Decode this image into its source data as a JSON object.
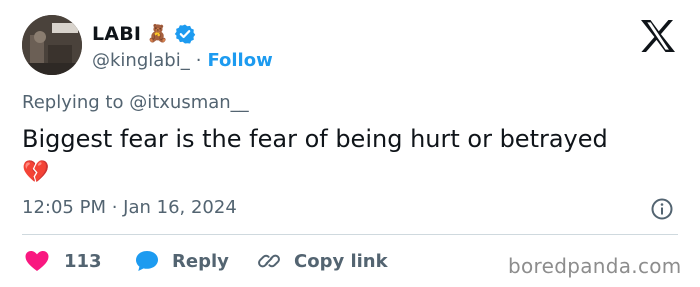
{
  "author": {
    "display_name": "LABI",
    "name_emoji": "🧸",
    "verified_icon": "verified-badge-icon",
    "handle": "@kinglabi_",
    "separator": "·",
    "follow_label": "Follow"
  },
  "reply_context": "Replying to @itxusman__",
  "tweet": {
    "text": "Biggest fear is the fear of being hurt or betrayed",
    "emoji": "💔"
  },
  "timestamp": "12:05 PM · Jan 16, 2024",
  "actions": {
    "like_count": "113",
    "reply_label": "Reply",
    "copy_label": "Copy link"
  },
  "watermark": "boredpanda.com",
  "colors": {
    "accent": "#1d9bf0",
    "like": "#f91880",
    "muted": "#536471",
    "text": "#0f1419",
    "divider": "#cfd9de"
  },
  "icons": {
    "logo": "x-logo-icon",
    "info": "info-icon",
    "like": "heart-icon",
    "reply": "speech-bubble-icon",
    "copy": "link-icon"
  }
}
